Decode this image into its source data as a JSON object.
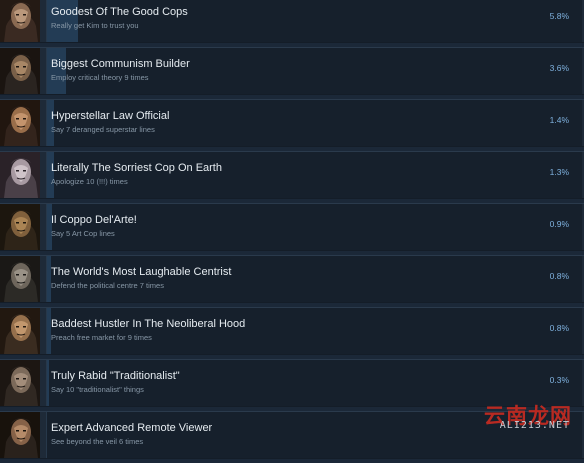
{
  "achievements": [
    {
      "title": "Goodest Of The Good Cops",
      "description": "Really get Kim to trust you",
      "percent": "5.8%",
      "progress": 5.8
    },
    {
      "title": "Biggest Communism Builder",
      "description": "Employ critical theory 9 times",
      "percent": "3.6%",
      "progress": 3.6
    },
    {
      "title": "Hyperstellar Law Official",
      "description": "Say 7 deranged superstar lines",
      "percent": "1.4%",
      "progress": 1.4
    },
    {
      "title": "Literally The Sorriest Cop On Earth",
      "description": "Apologize 10 (!!!) times",
      "percent": "1.3%",
      "progress": 1.3
    },
    {
      "title": "Il Coppo Del'Arte!",
      "description": "Say 5 Art Cop lines",
      "percent": "0.9%",
      "progress": 0.9
    },
    {
      "title": "The World's Most Laughable Centrist",
      "description": "Defend the political centre 7 times",
      "percent": "0.8%",
      "progress": 0.8
    },
    {
      "title": "Baddest Hustler In The Neoliberal Hood",
      "description": "Preach free market for 9 times",
      "percent": "0.8%",
      "progress": 0.8
    },
    {
      "title": "Truly Rabid \"Traditionalist\"",
      "description": "Say 10 \"traditionalist\" things",
      "percent": "0.3%",
      "progress": 0.3
    },
    {
      "title": "Expert Advanced Remote Viewer",
      "description": "See beyond the veil 6 times",
      "percent": "",
      "progress": 0
    }
  ],
  "watermark": {
    "chinese": "云南龙网",
    "latin": "ALI213.NET"
  },
  "colors": {
    "background": "#1b2838",
    "progress_bar": "#233c55",
    "title": "#e6ecf1",
    "description": "#8797a6",
    "percent": "#7fb1de",
    "watermark": "#b82a22"
  }
}
